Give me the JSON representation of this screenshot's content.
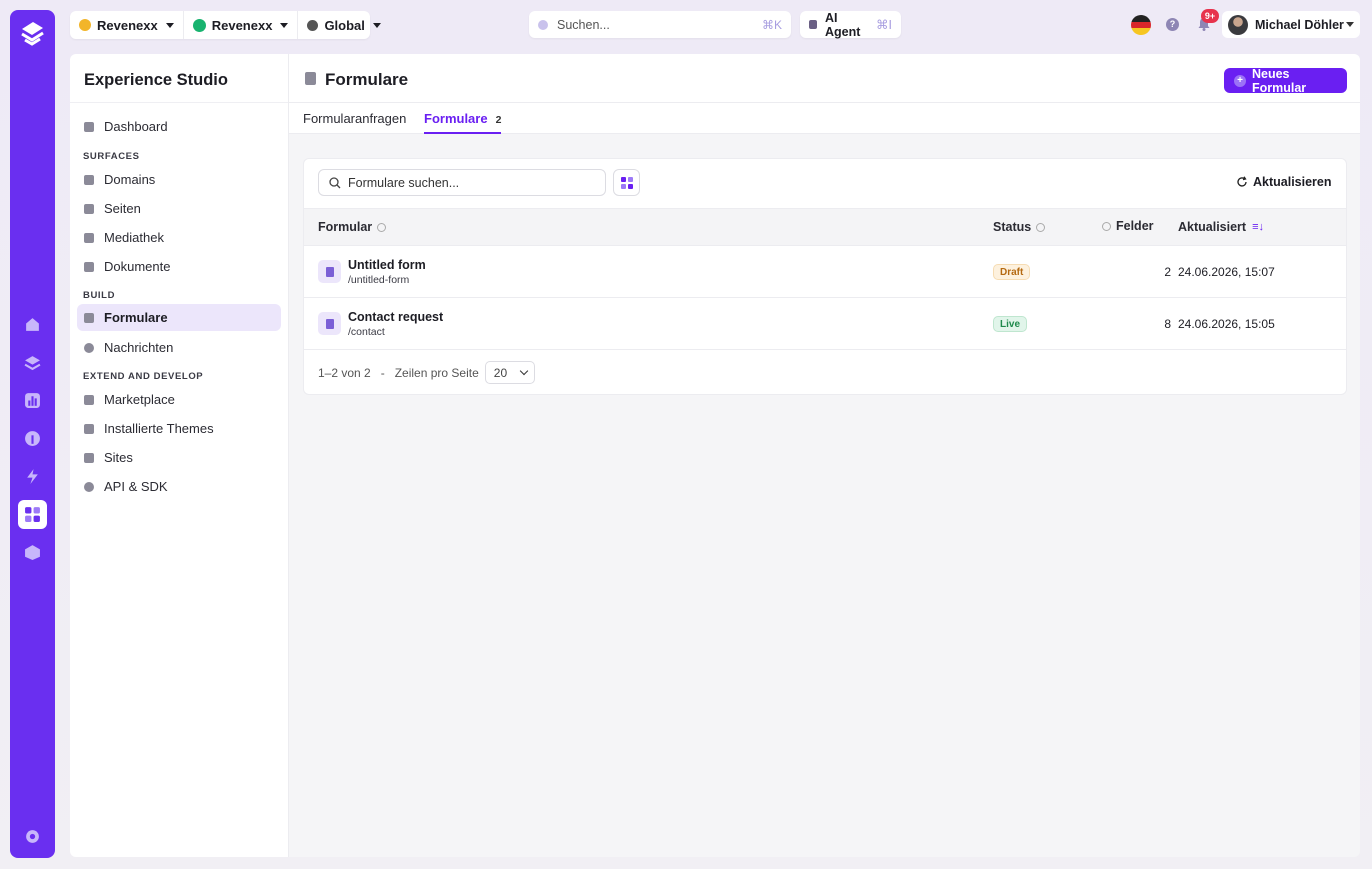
{
  "colors": {
    "accent": "#6a1ff2",
    "rail": "#6a2ff0",
    "draft": "#b56a12",
    "live": "#1f8a4c"
  },
  "topbar": {
    "selectors": [
      {
        "label": "Revenexx",
        "icon": "brand-logo-icon",
        "color": "#f2b52a"
      },
      {
        "label": "Revenexx",
        "icon": "green-dot-icon",
        "color": "#18b36f"
      },
      {
        "label": "Global",
        "icon": "globe-icon",
        "color": "#555"
      }
    ],
    "search": {
      "placeholder": "Suchen...",
      "shortcut": "⌘K"
    },
    "ai_agent": {
      "label": "AI Agent",
      "shortcut": "⌘I"
    },
    "notifications_badge": "9+",
    "help_label": "?",
    "user": {
      "name": "Michael Döhler"
    }
  },
  "sidebar": {
    "title": "Experience Studio",
    "items": [
      {
        "label": "Dashboard"
      },
      {
        "section": "SURFACES"
      },
      {
        "label": "Domains"
      },
      {
        "label": "Seiten"
      },
      {
        "label": "Mediathek"
      },
      {
        "label": "Dokumente"
      },
      {
        "section": "BUILD"
      },
      {
        "label": "Formulare",
        "active": true
      },
      {
        "label": "Nachrichten"
      },
      {
        "section": "EXTEND AND DEVELOP"
      },
      {
        "label": "Marketplace"
      },
      {
        "label": "Installierte Themes"
      },
      {
        "label": "Sites"
      },
      {
        "label": "API & SDK"
      }
    ]
  },
  "main": {
    "title": "Formulare",
    "new_button": "Neues Formular",
    "tabs": [
      {
        "label": "Formularanfragen",
        "active": false
      },
      {
        "label": "Formulare",
        "count": "2",
        "active": true
      }
    ],
    "filter_placeholder": "Formulare suchen...",
    "refresh_label": "Aktualisieren",
    "columns": {
      "form": "Formular",
      "status": "Status",
      "fields": "Felder",
      "updated": "Aktualisiert"
    },
    "rows": [
      {
        "name": "Untitled form",
        "slug": "/untitled-form",
        "status": "Draft",
        "fields": "2",
        "updated": "24.06.2026, 15:07"
      },
      {
        "name": "Contact request",
        "slug": "/contact",
        "status": "Live",
        "fields": "8",
        "updated": "24.06.2026, 15:05"
      }
    ],
    "pager": {
      "range": "1–2 von 2",
      "separator": "-",
      "rows_per_page_label": "Zeilen pro Seite",
      "rows_per_page": "20"
    }
  }
}
